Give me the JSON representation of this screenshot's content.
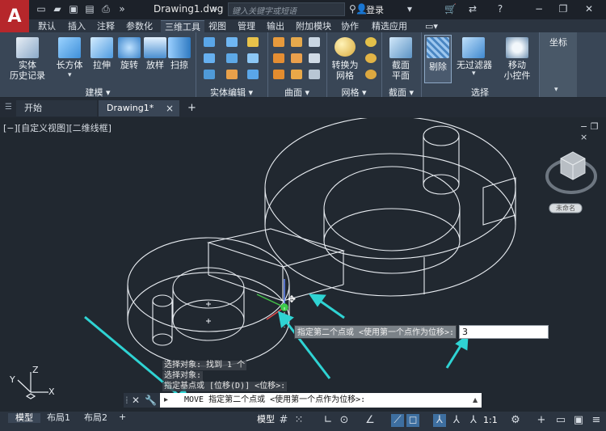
{
  "titlebar": {
    "app_logo": "A",
    "doc_title": "Drawing1.dwg",
    "search_placeholder": "键入关键字或短语",
    "login": "登录"
  },
  "ribbon_tabs": [
    "默认",
    "插入",
    "注释",
    "参数化",
    "三维工具",
    "视图",
    "管理",
    "输出",
    "附加模块",
    "协作",
    "精选应用"
  ],
  "active_ribbon_tab": "三维工具",
  "ribbon": {
    "solid_history": [
      "实体",
      "历史记录"
    ],
    "box": "长方体",
    "extrude": "拉伸",
    "revolve": "旋转",
    "loft": "放样",
    "sweep": "扫掠",
    "convert_mesh": [
      "转换为",
      "网格"
    ],
    "section_plane": [
      "截面",
      "平面"
    ],
    "cull": "剔除",
    "no_filter": "无过滤器",
    "move_gizmo": [
      "移动",
      "小控件"
    ],
    "coordinates": "坐标",
    "panels": {
      "modeling": "建模 ▾",
      "solid_edit": "实体编辑 ▾",
      "surface": "曲面 ▾",
      "mesh": "网格 ▾",
      "section": "截面 ▾",
      "selection": "选择"
    }
  },
  "file_tabs": {
    "start": "开始",
    "drawing": "Drawing1*",
    "close": "×",
    "add": "+"
  },
  "viewport": {
    "label": "[−][自定义视图][二维线框]",
    "controls": "−  ❐  ×",
    "viewcube_label": "未命名"
  },
  "command": {
    "history": [
      "选择对象: 找到 1 个",
      "选择对象:",
      "指定基点或 [位移(D)] <位移>:"
    ],
    "current": "MOVE 指定第二个点或 <使用第一个点作为位移>:",
    "prompt_icon": "▸"
  },
  "dynamic_input": {
    "prompt": "指定第二个点或 <使用第一个点作为位移>:",
    "value": "3"
  },
  "status": {
    "tabs": [
      "模型",
      "布局1",
      "布局2"
    ],
    "active_tab": "模型",
    "model_button": "模型",
    "scale": "1:1"
  },
  "ucs": {
    "x": "X",
    "y": "Y",
    "z": "Z"
  },
  "colors": {
    "accent_cyan": "#2fd3d3",
    "app_red": "#b6272b",
    "ribbon_bg": "#394656",
    "canvas_bg": "#212830"
  }
}
